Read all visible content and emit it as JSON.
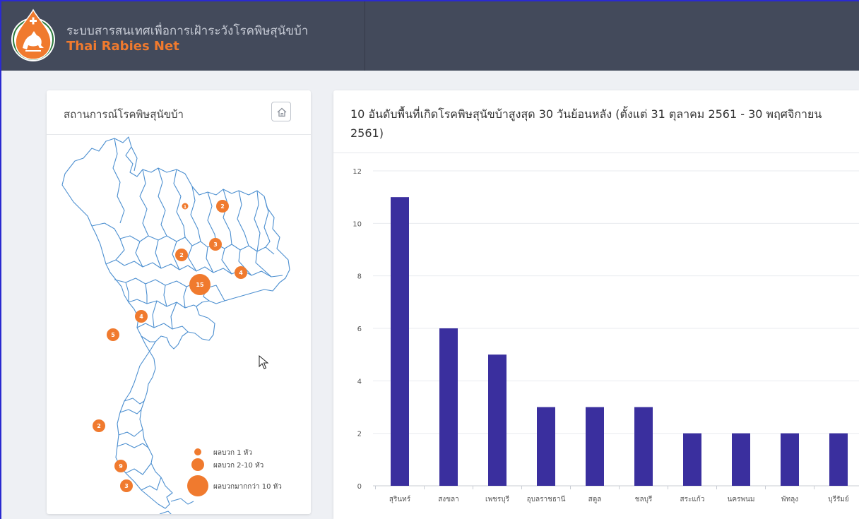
{
  "header": {
    "title_th": "ระบบสารสนเทศเพื่อการเฝ้าระวังโรคพิษสุนัขบ้า",
    "title_en": "Thai Rabies Net",
    "logo_icon": "rabies-net-logo-icon",
    "bg_color": "#434a5b",
    "accent_color": "#f07a2e"
  },
  "map_panel": {
    "title": "สถานการณ์โรคพิษสุนัขบ้า",
    "home_icon": "home-icon",
    "markers": [
      {
        "label": "1"
      },
      {
        "label": "2"
      },
      {
        "label": "3"
      },
      {
        "label": "2"
      },
      {
        "label": "4"
      },
      {
        "label": "15"
      },
      {
        "label": "4"
      },
      {
        "label": "5"
      },
      {
        "label": "2"
      },
      {
        "label": "9"
      },
      {
        "label": "3"
      }
    ],
    "legend": [
      {
        "label": "ผลบวก 1 หัว"
      },
      {
        "label": "ผลบวก 2-10 หัว"
      },
      {
        "label": "ผลบวกมากกว่า 10 หัว"
      }
    ]
  },
  "chart_panel": {
    "title": "10 อันดับพื้นที่เกิดโรคพิษสุนัขบ้าสูงสุด 30 วันย้อนหลัง (ตั้งแต่ 31 ตุลาคม 2561 - 30 พฤศจิกายน 2561)"
  },
  "chart_data": {
    "type": "bar",
    "categories": [
      "สุรินทร์",
      "สงขลา",
      "เพชรบุรี",
      "อุบลราชธานี",
      "สตูล",
      "ชลบุรี",
      "สระแก้ว",
      "นครพนม",
      "พัทลุง",
      "บุรีรัมย์"
    ],
    "values": [
      11,
      6,
      5,
      3,
      3,
      3,
      2,
      2,
      2,
      2
    ],
    "ylim": [
      0,
      12
    ],
    "yticks": [
      0,
      2,
      4,
      6,
      8,
      10,
      12
    ],
    "grid": true,
    "bar_color": "#3a2f9e"
  }
}
